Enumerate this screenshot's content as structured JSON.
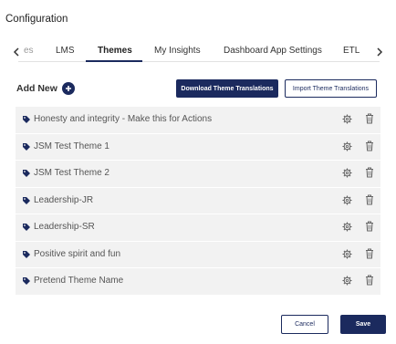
{
  "page": {
    "title": "Configuration"
  },
  "tabs": [
    {
      "label": "es",
      "active": false
    },
    {
      "label": "LMS",
      "active": false
    },
    {
      "label": "Themes",
      "active": true
    },
    {
      "label": "My Insights",
      "active": false
    },
    {
      "label": "Dashboard App Settings",
      "active": false
    },
    {
      "label": "ETL",
      "active": false
    }
  ],
  "toolbar": {
    "add_new_label": "Add New",
    "download_label": "Download Theme Translations",
    "import_label": "Import Theme Translations"
  },
  "themes": [
    {
      "name": "Honesty and integrity - Make this for Actions"
    },
    {
      "name": "JSM Test Theme 1"
    },
    {
      "name": "JSM Test Theme 2"
    },
    {
      "name": "Leadership-JR"
    },
    {
      "name": "Leadership-SR"
    },
    {
      "name": "Positive spirit and fun"
    },
    {
      "name": "Pretend Theme Name"
    }
  ],
  "footer": {
    "cancel_label": "Cancel",
    "save_label": "Save"
  },
  "colors": {
    "accent": "#1b2a5e",
    "row_bg": "#f2f2f2",
    "icon": "#666666"
  },
  "icons": {
    "tab_left": "chevron-left-icon",
    "tab_right": "chevron-right-icon",
    "add": "plus-circle-icon",
    "row_tag": "tag-icon",
    "row_settings": "gear-icon",
    "row_delete": "trash-icon"
  }
}
